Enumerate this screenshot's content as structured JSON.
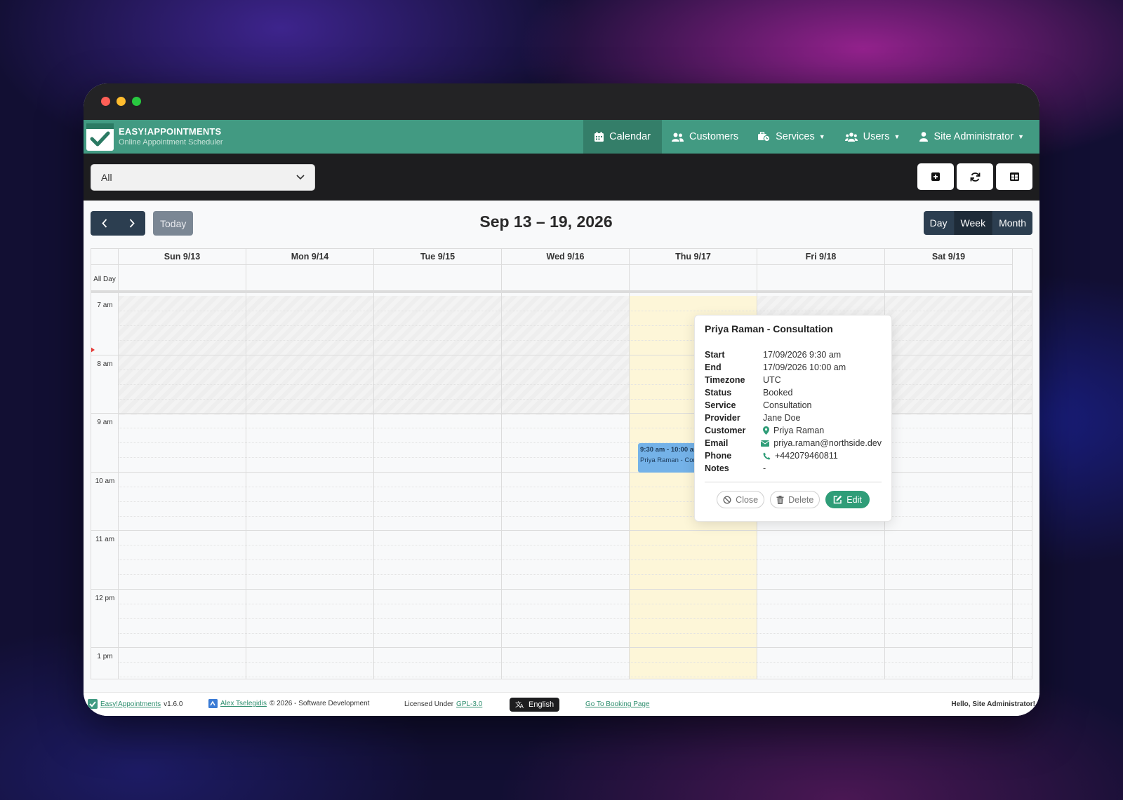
{
  "app": {
    "name": "EASY!APPOINTMENTS",
    "tagline": "Online Appointment Scheduler"
  },
  "nav": {
    "items": [
      {
        "label": "Calendar",
        "icon": "calendar-icon",
        "active": true
      },
      {
        "label": "Customers",
        "icon": "users-icon"
      },
      {
        "label": "Services",
        "icon": "business-time-icon",
        "dropdown": true
      },
      {
        "label": "Users",
        "icon": "users-cog-icon",
        "dropdown": true
      },
      {
        "label": "Site Administrator",
        "icon": "user-icon",
        "dropdown": true
      }
    ]
  },
  "toolbar": {
    "filter_value": "All",
    "buttons": [
      "add-appointment-icon",
      "reload-icon",
      "table-view-icon"
    ]
  },
  "calendar": {
    "today_label": "Today",
    "range_title": "Sep 13 – 19, 2026",
    "views": [
      "Day",
      "Week",
      "Month"
    ],
    "active_view": "Week",
    "all_day_label": "All Day",
    "days": [
      "Sun 9/13",
      "Mon 9/14",
      "Tue 9/15",
      "Wed 9/16",
      "Thu 9/17",
      "Fri 9/18",
      "Sat 9/19"
    ],
    "hours": [
      "7 am",
      "8 am",
      "9 am",
      "10 am",
      "11 am",
      "12 pm",
      "1 pm"
    ]
  },
  "event": {
    "time": "9:30 am - 10:00 am",
    "title": "Priya Raman - Consultation",
    "color": "#74b2e8"
  },
  "popover": {
    "title": "Priya Raman - Consultation",
    "rows": [
      {
        "key": "Start",
        "value": "17/09/2026 9:30 am"
      },
      {
        "key": "End",
        "value": "17/09/2026 10:00 am"
      },
      {
        "key": "Timezone",
        "value": "UTC"
      },
      {
        "key": "Status",
        "value": "Booked"
      },
      {
        "key": "Service",
        "value": "Consultation"
      },
      {
        "key": "Provider",
        "value": "Jane Doe"
      },
      {
        "key": "Customer",
        "value": "Priya Raman",
        "icon": "map-marker-icon"
      },
      {
        "key": "Email",
        "value": "priya.raman@northside.dev",
        "icon": "envelope-icon"
      },
      {
        "key": "Phone",
        "value": "+442079460811",
        "icon": "phone-icon"
      },
      {
        "key": "Notes",
        "value": "-"
      }
    ],
    "close_label": "Close",
    "delete_label": "Delete",
    "edit_label": "Edit"
  },
  "footer": {
    "product_link": "Easy!Appointments",
    "version": "v1.6.0",
    "author_link": "Alex Tselegidis",
    "copyright": "© 2026 - Software Development",
    "license_prefix": "Licensed Under",
    "license_link": "GPL-3.0",
    "language": "English",
    "booking_link": "Go To Booking Page",
    "hello": "Hello, Site Administrator!"
  },
  "colors": {
    "brand_green": "#429a82",
    "nav_dark": "#2c3e50",
    "today_highlight": "#fdf6d8"
  }
}
